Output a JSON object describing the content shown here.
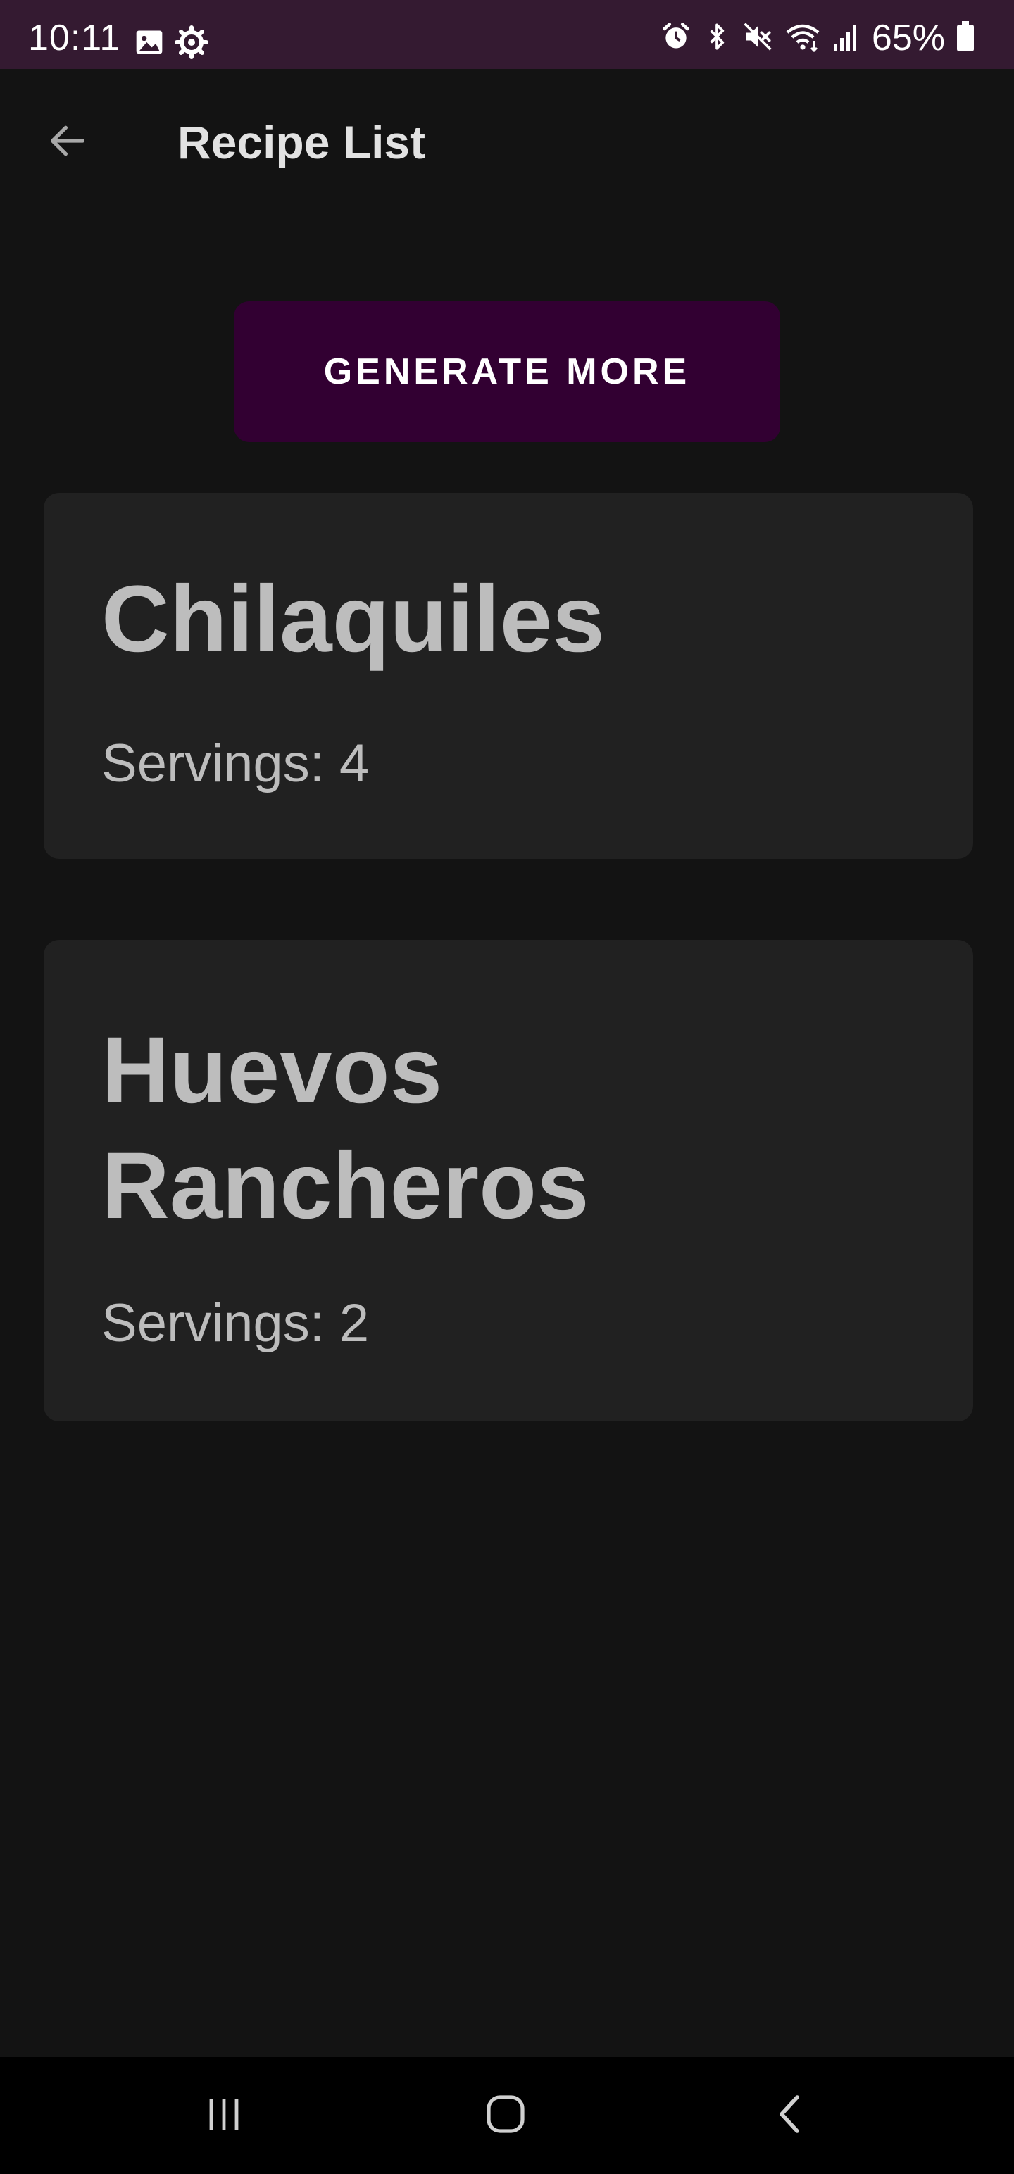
{
  "status_bar": {
    "time": "10:11",
    "battery": "65%",
    "left_icons": [
      "image-icon",
      "settings-cog-icon"
    ],
    "right_icons": [
      "alarm-icon",
      "bluetooth-icon",
      "mute-icon",
      "wifi-icon",
      "signal-icon",
      "battery-icon"
    ]
  },
  "app_bar": {
    "back_icon": "arrow-back-icon",
    "title": "Recipe List"
  },
  "generate_button": {
    "label": "GENERATE MORE"
  },
  "recipes": [
    {
      "name": "Chilaquiles",
      "servings": "Servings: 4"
    },
    {
      "name": "Huevos Rancheros",
      "servings": "Servings: 2"
    }
  ],
  "nav_bar": {
    "buttons": [
      "recents-icon",
      "home-icon",
      "back-icon"
    ]
  },
  "colors": {
    "background": "#131313",
    "status_bar": "#341a31",
    "button": "#320032",
    "card": "#212121",
    "card_text": "#bdbdbd"
  }
}
